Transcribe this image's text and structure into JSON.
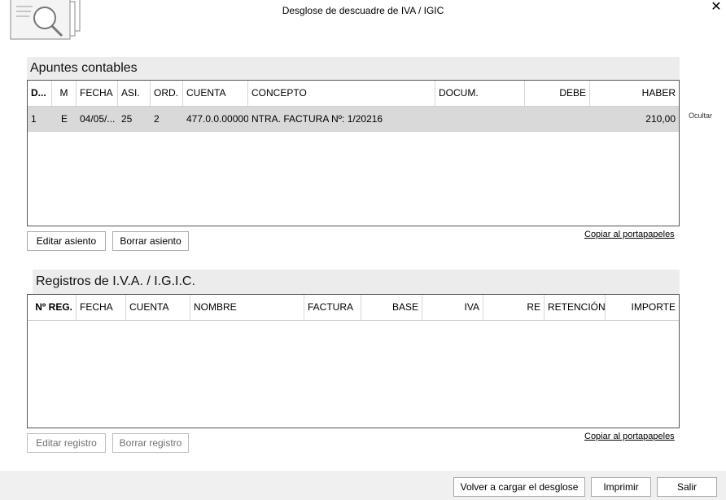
{
  "window": {
    "title": "Desglose de descuadre de IVA / IGIC",
    "close_icon": "close-icon",
    "app_icon": "search-documents-icon"
  },
  "apuntes": {
    "header": "Apuntes contables",
    "hide_label": "Ocultar",
    "columns": [
      "D...",
      "M",
      "FECHA",
      "ASI.",
      "ORD.",
      "CUENTA",
      "CONCEPTO",
      "DOCUM.",
      "DEBE",
      "HABER"
    ],
    "rows": [
      {
        "d": "1",
        "m": "E",
        "fecha": "04/05/...",
        "asi": "25",
        "ord": "2",
        "cuenta": "477.0.0.00000",
        "concepto": "NTRA. FACTURA Nº: 1/20216",
        "docum": "",
        "debe": "",
        "haber": "210,00"
      }
    ],
    "edit_button": "Editar asiento",
    "delete_button": "Borrar asiento",
    "copy_link": "Copiar al portapapeles"
  },
  "registros": {
    "header": "Registros de I.V.A. / I.G.I.C.",
    "columns": [
      "Nº REG.",
      "FECHA",
      "CUENTA",
      "NOMBRE",
      "FACTURA",
      "BASE",
      "IVA",
      "RE",
      "RETENCIÓN",
      "IMPORTE"
    ],
    "edit_button": "Editar registro",
    "delete_button": "Borrar registro",
    "copy_link": "Copiar al portapapeles"
  },
  "footer": {
    "reload_button": "Volver a cargar el desglose",
    "print_button": "Imprimir",
    "exit_button": "Salir"
  }
}
